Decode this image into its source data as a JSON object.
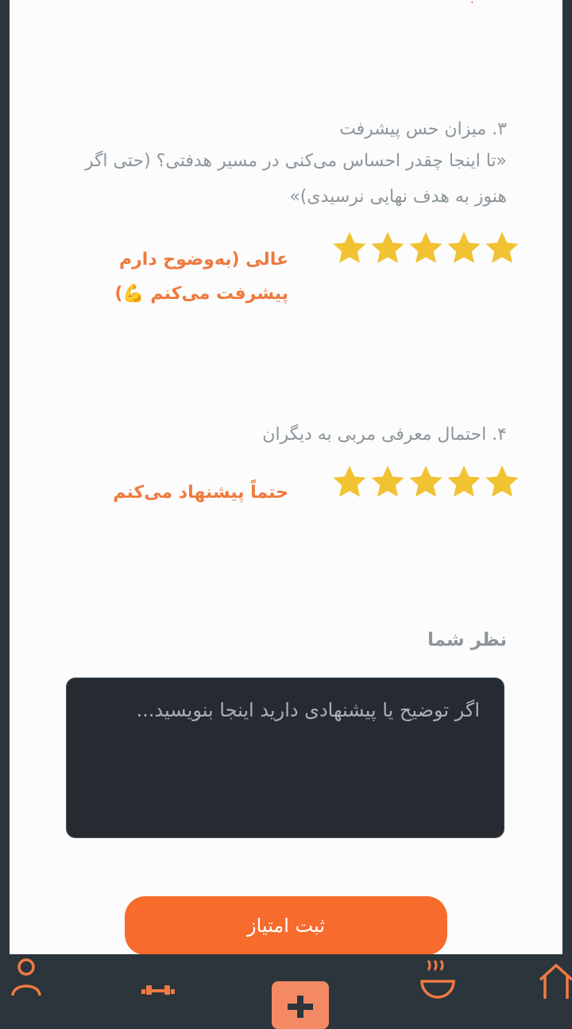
{
  "questions": [
    {
      "title": "۳. میزان حس پیشرفت",
      "text": "«تا اینجا چقدر احساس می‌کنی در مسیر هدفتی؟ (حتی اگر هنوز به هدف نهایی نرسیدی)»",
      "rating": 5,
      "max_rating": 5,
      "rating_label": "عالی (به‌وضوح دارم پیشرفت می‌کنم 💪)"
    },
    {
      "title": "۴. احتمال معرفی مربی به دیگران",
      "rating": 5,
      "max_rating": 5,
      "rating_label": "حتماً پیشنهاد می‌کنم"
    }
  ],
  "comment": {
    "label": "نظر شما",
    "placeholder": "اگر توضیح یا پیشنهادی دارید اینجا بنویسید..."
  },
  "submit_label": "ثبت امتیاز",
  "colors": {
    "accent": "#f76b2d",
    "star": "#f1c232",
    "label": "#ef7a3c",
    "nav_bg": "#2b353b"
  },
  "nav": [
    "profile-icon",
    "dumbbell-icon",
    "plus-icon",
    "food-bowl-icon",
    "home-icon"
  ]
}
